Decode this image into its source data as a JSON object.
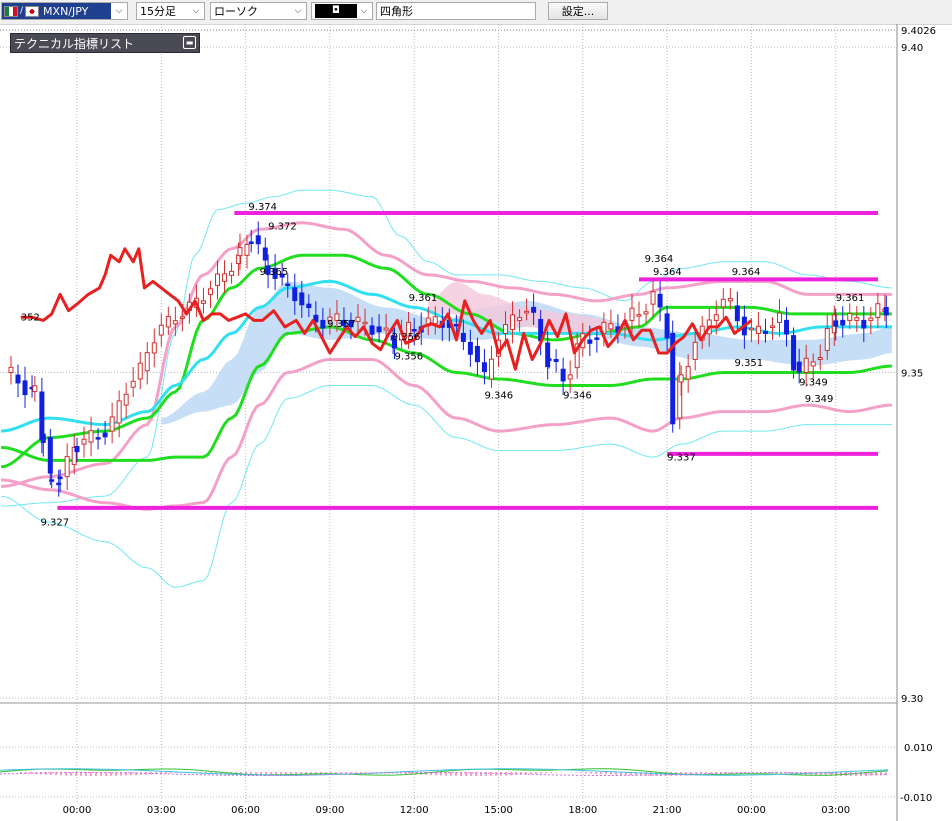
{
  "toolbar": {
    "pair_label": "MXN/JPY",
    "timeframe": "15分足",
    "chart_type": "ローソク",
    "color_symbol": "◘",
    "shape": "四角形",
    "settings_label": "設定..."
  },
  "panel": {
    "title": "テクニカル指標リスト"
  },
  "colors": {
    "up_candle": "#d03030",
    "down_candle": "#1020e0",
    "sma_red": "#e82020",
    "bb_mid_green": "#20dd20",
    "bb_pink": "#f4a0c8",
    "bb_cyan": "#70e8f0",
    "cloud_blue": "#bcd8f4",
    "cloud_pink": "#f4c8dc",
    "line_cyan": "#30e0f0",
    "magenta": "#ee22dd"
  },
  "chart_data": {
    "type": "line",
    "x_ticks": [
      "00:00",
      "03:00",
      "06:00",
      "09:00",
      "12:00",
      "15:00",
      "18:00",
      "21:00",
      "00:00",
      "03:00"
    ],
    "y_ticks": [
      "9.4026",
      "9.40",
      "9.35",
      "9.30"
    ],
    "sub_y_ticks": [
      "0.010",
      "-0.010"
    ],
    "ylim": [
      9.297,
      9.4026
    ],
    "price_annotations": [
      {
        "text": "352",
        "t": -2.0,
        "price": 9.358
      },
      {
        "text": "9.374",
        "t": 6.1,
        "price": 9.375
      },
      {
        "text": "9.372",
        "t": 6.8,
        "price": 9.372
      },
      {
        "text": "9.365",
        "t": 6.5,
        "price": 9.365
      },
      {
        "text": "9.357",
        "t": 8.9,
        "price": 9.357
      },
      {
        "text": "9.361",
        "t": 11.8,
        "price": 9.361
      },
      {
        "text": "9.356",
        "t": 11.2,
        "price": 9.355
      },
      {
        "text": "9.356",
        "t": 11.3,
        "price": 9.352
      },
      {
        "text": "9.346",
        "t": 14.5,
        "price": 9.346
      },
      {
        "text": "9.346",
        "t": 17.3,
        "price": 9.346
      },
      {
        "text": "9.364",
        "t": 20.2,
        "price": 9.367
      },
      {
        "text": "9.364",
        "t": 20.5,
        "price": 9.365
      },
      {
        "text": "9.364",
        "t": 23.3,
        "price": 9.365
      },
      {
        "text": "9.351",
        "t": 23.4,
        "price": 9.351
      },
      {
        "text": "9.337",
        "t": 21.0,
        "price": 9.3365
      },
      {
        "text": "9.349",
        "t": 25.7,
        "price": 9.348
      },
      {
        "text": "9.349",
        "t": 25.9,
        "price": 9.3455
      },
      {
        "text": "9.361",
        "t": 27.0,
        "price": 9.361
      },
      {
        "text": "9.327",
        "t": -1.3,
        "price": 9.3265
      }
    ],
    "horizontal_lines": [
      {
        "from": 5.6,
        "to": 29.0,
        "price": 9.3745
      },
      {
        "from": 20.0,
        "to": 29.0,
        "price": 9.3643
      },
      {
        "from": 21.0,
        "to": 28.6,
        "price": 9.3375
      },
      {
        "from": -0.7,
        "to": 29.0,
        "price": 9.3292
      }
    ],
    "series": [
      {
        "key": "sma_red",
        "x": [
          -2.0,
          -1.6,
          -1.2,
          -0.9,
          -0.6,
          -0.3,
          0.0,
          0.4,
          0.8,
          1.0,
          1.2,
          1.5,
          1.7,
          2.0,
          2.2,
          2.4,
          2.7,
          3.0,
          3.3,
          3.6,
          3.9,
          4.2,
          4.5,
          4.8,
          5.1,
          5.4,
          5.7,
          6.0,
          6.3,
          6.6,
          7.0,
          7.4,
          7.8,
          8.1,
          8.4,
          8.7,
          9.0,
          9.3,
          9.6,
          9.9,
          10.2,
          10.5,
          10.8,
          11.1,
          11.4,
          11.7,
          12.0,
          12.3,
          12.6,
          12.9,
          13.2,
          13.5,
          13.8,
          14.1,
          14.4,
          14.7,
          15.0,
          15.3,
          15.6,
          15.9,
          16.2,
          16.5,
          16.8,
          17.1,
          17.4,
          17.7,
          18.0,
          18.3,
          18.6,
          18.9,
          19.2,
          19.5,
          19.8,
          20.1,
          20.4,
          20.7,
          21.0,
          21.3,
          21.6,
          21.9,
          22.2,
          22.5,
          22.8,
          23.1,
          23.4,
          23.7,
          24.0
        ],
        "y": [
          9.3585,
          9.3585,
          9.358,
          9.359,
          9.362,
          9.3595,
          9.3605,
          9.362,
          9.363,
          9.365,
          9.368,
          9.367,
          9.369,
          9.367,
          9.369,
          9.363,
          9.364,
          9.363,
          9.362,
          9.361,
          9.359,
          9.361,
          9.358,
          9.359,
          9.359,
          9.358,
          9.3585,
          9.359,
          9.358,
          9.358,
          9.3595,
          9.357,
          9.358,
          9.356,
          9.358,
          9.3555,
          9.353,
          9.355,
          9.357,
          9.3555,
          9.357,
          9.3545,
          9.3535,
          9.356,
          9.358,
          9.3545,
          9.355,
          9.357,
          9.3575,
          9.357,
          9.359,
          9.355,
          9.361,
          9.358,
          9.356,
          9.358,
          9.353,
          9.355,
          9.3505,
          9.356,
          9.352,
          9.3545,
          9.358,
          9.3555,
          9.359,
          9.353,
          9.355,
          9.3565,
          9.357,
          9.354,
          9.3555,
          9.358,
          9.355,
          9.3565,
          9.3565,
          9.353,
          9.353,
          9.3545,
          9.3555,
          9.3575,
          9.355,
          9.357,
          9.357,
          9.3585,
          9.356,
          9.357,
          9.358
        ]
      }
    ]
  }
}
